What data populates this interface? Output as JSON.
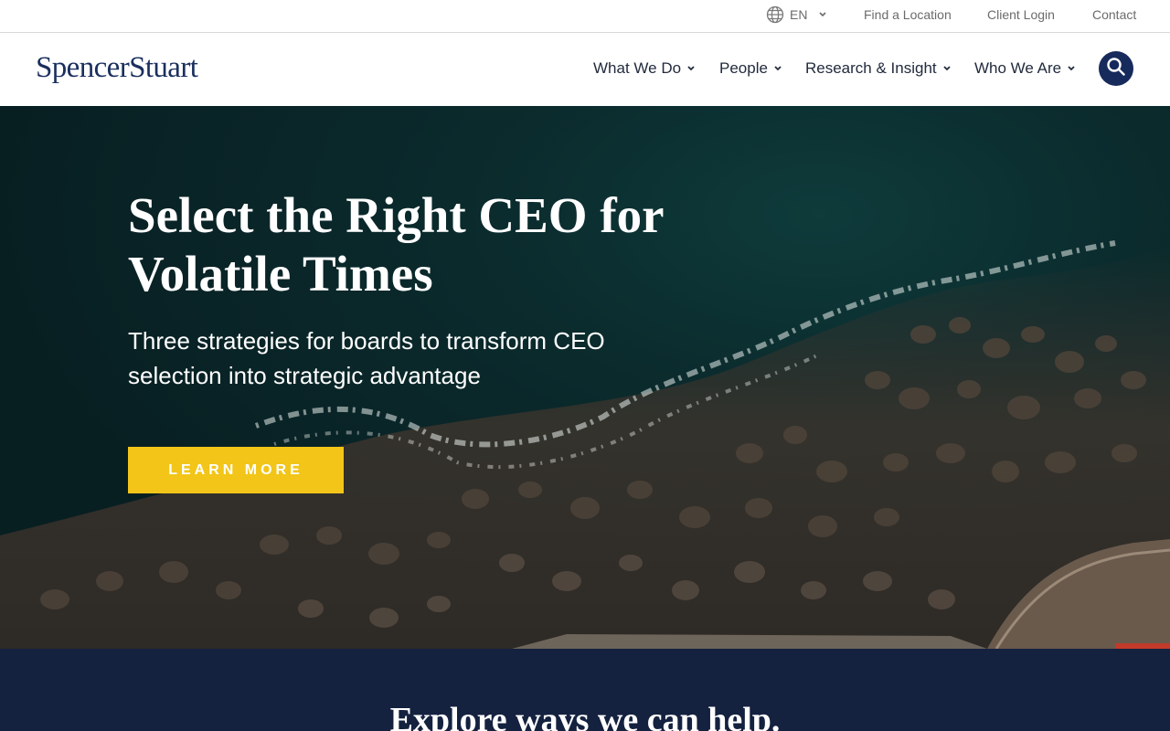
{
  "utility": {
    "language": "EN",
    "links": [
      "Find a Location",
      "Client Login",
      "Contact"
    ]
  },
  "brand": {
    "logo_text": "SpencerStuart"
  },
  "nav": {
    "items": [
      "What We Do",
      "People",
      "Research & Insight",
      "Who We Are"
    ]
  },
  "hero": {
    "title": "Select the Right CEO for Volatile Times",
    "subtitle": "Three strategies for boards to transform CEO selection into strategic advantage",
    "cta_label": "LEARN MORE"
  },
  "explore": {
    "title": "Explore ways we can help."
  },
  "icons": {
    "language": "globe-icon",
    "dropdown": "chevron-down-icon",
    "search": "search-icon"
  },
  "colors": {
    "brand_navy": "#172a5c",
    "cta_yellow": "#f2c518",
    "band_navy": "#14213f"
  }
}
